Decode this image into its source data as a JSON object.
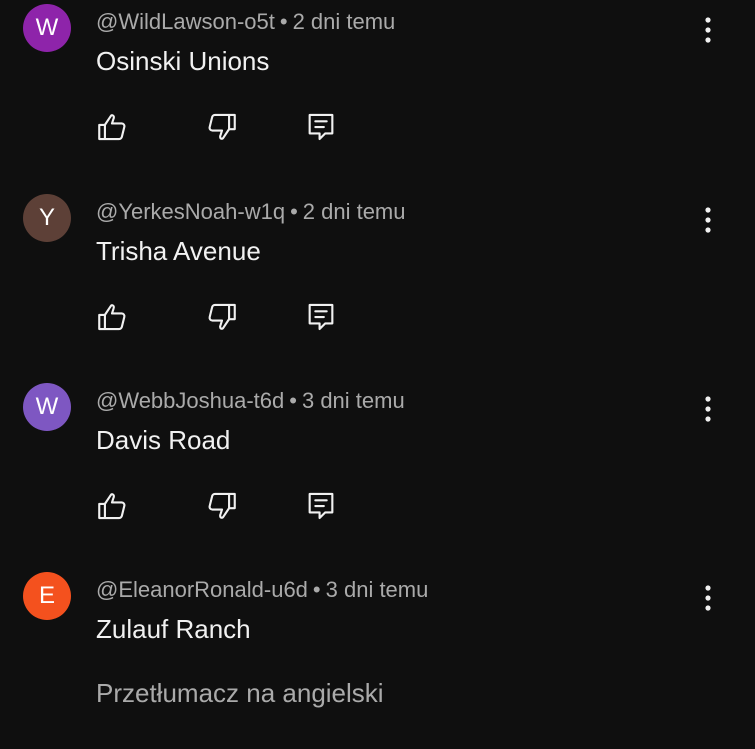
{
  "comments": [
    {
      "avatar_letter": "W",
      "avatar_color": "#8e24aa",
      "author": "@WildLawson-o5t",
      "separator": "•",
      "time": "2 dni temu",
      "text": "Osinski Unions"
    },
    {
      "avatar_letter": "Y",
      "avatar_color": "#5d4037",
      "author": "@YerkesNoah-w1q",
      "separator": "•",
      "time": "2 dni temu",
      "text": "Trisha Avenue"
    },
    {
      "avatar_letter": "W",
      "avatar_color": "#7e57c2",
      "author": "@WebbJoshua-t6d",
      "separator": "•",
      "time": "3 dni temu",
      "text": "Davis Road"
    },
    {
      "avatar_letter": "E",
      "avatar_color": "#f4511e",
      "author": "@EleanorRonald-u6d",
      "separator": "•",
      "time": "3 dni temu",
      "text": "Zulauf Ranch",
      "translate_label": "Przetłumacz na angielski"
    }
  ],
  "icons": {
    "like": "thumbs-up-icon",
    "dislike": "thumbs-down-icon",
    "reply": "reply-icon",
    "more": "more-vert-icon"
  }
}
